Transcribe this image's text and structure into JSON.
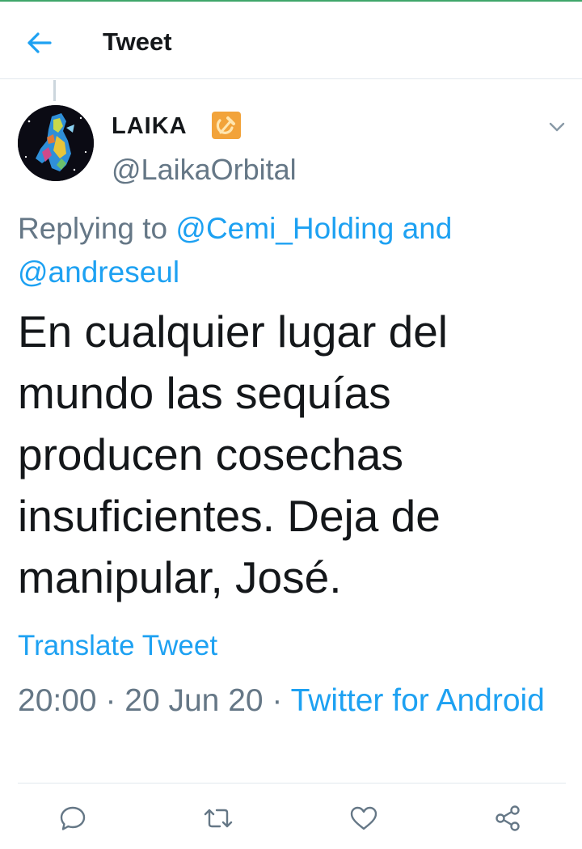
{
  "header": {
    "title": "Tweet"
  },
  "tweet": {
    "author_name": "LAIKA",
    "author_handle": "@LaikaOrbital",
    "replying_prefix": "Replying to ",
    "replying_user1": "@Cemi_Holding",
    "replying_and": " and",
    "replying_user2": "@andreseul",
    "text": "En cualquier lugar del mundo las sequías producen cosechas insuficientes. Deja de manipular, José.",
    "translate_label": "Translate Tweet",
    "time": "20:00",
    "sep1": " · ",
    "date": "20 Jun 20",
    "sep2": " · ",
    "source": "Twitter for Android"
  },
  "icons": {
    "back": "arrow-left-icon",
    "more": "chevron-down-icon",
    "flag": "hammer-sickle-icon",
    "reply": "reply-icon",
    "retweet": "retweet-icon",
    "like": "heart-icon",
    "share": "share-icon"
  },
  "colors": {
    "accent": "#1da1f2",
    "secondary_text": "#657786",
    "primary_text": "#14171a",
    "divider": "#e1e8ed",
    "top_status_line": "#3fa66a"
  }
}
